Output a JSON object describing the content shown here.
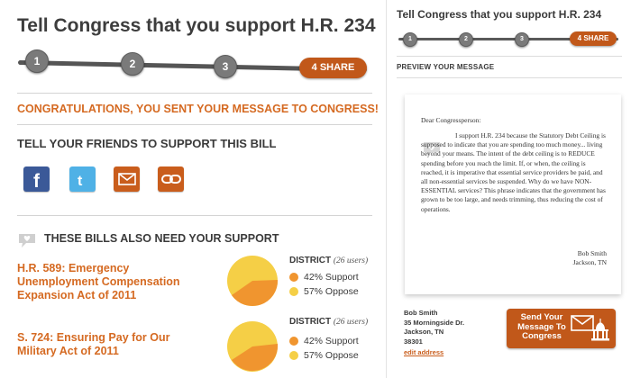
{
  "left": {
    "title": "Tell Congress that you support H.R. 234",
    "steps": [
      "1",
      "2",
      "3"
    ],
    "active_step": "4  SHARE",
    "congrats": "CONGRATULATIONS, YOU SENT YOUR MESSAGE TO CONGRESS!",
    "share_heading": "TELL YOUR FRIENDS TO SUPPORT THIS BILL",
    "share_icons": [
      "facebook-icon",
      "twitter-icon",
      "email-icon",
      "link-icon"
    ],
    "bills_heading": "THESE BILLS ALSO NEED YOUR SUPPORT",
    "bills": [
      {
        "title": "H.R. 589: Emergency Unemployment Compensation Expansion Act of 2011",
        "district_label": "DISTRICT",
        "users": "(26 users)",
        "support_label": "42% Support",
        "oppose_label": "57% Oppose",
        "support": 42,
        "oppose": 57
      },
      {
        "title": "S. 724: Ensuring Pay for Our Military Act of 2011",
        "district_label": "DISTRICT",
        "users": "(26 users)",
        "support_label": "42% Support",
        "oppose_label": "57% Oppose",
        "support": 42,
        "oppose": 57
      }
    ]
  },
  "right": {
    "title": "Tell Congress that you support H.R. 234",
    "steps": [
      "1",
      "2",
      "3"
    ],
    "active_step": "4  SHARE",
    "preview_label": "PREVIEW YOUR MESSAGE",
    "letter": {
      "salutation": "Dear Congressperson:",
      "body": "I support H.R. 234 because the Statutory Debt Ceiling is supposed to indicate that you are spending too much money... living beyond your means. The intent of the debt ceiling is to REDUCE spending before you reach the limit. If, or when, the ceiling is reached, it is imperative that essential service providers be paid, and all non-essential services be suspended. Why do we have NON-ESSENTIAL services? This phrase indicates that the government has grown to be too large, and needs trimming, thus reducing the cost of operations.",
      "sig_name": "Bob Smith",
      "sig_place": "Jackson, TN"
    },
    "address": {
      "name": "Bob Smith",
      "street": "35 Morningside Dr.",
      "city": "Jackson, TN",
      "zip": "38301",
      "edit": "edit address"
    },
    "send_button": "Send Your Message To Congress"
  },
  "colors": {
    "accent": "#c1581a",
    "orange_text": "#d56a22",
    "support": "#f0952f",
    "oppose": "#f5cf46",
    "facebook": "#3b5998",
    "twitter": "#4fb1e6"
  }
}
